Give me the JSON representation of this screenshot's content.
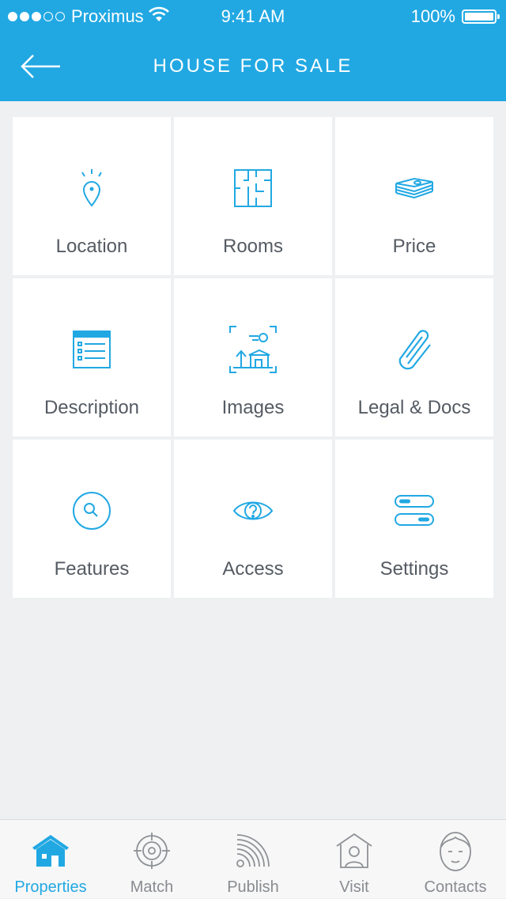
{
  "status_bar": {
    "carrier": "Proximus",
    "time": "9:41 AM",
    "battery": "100%"
  },
  "header": {
    "title": "HOUSE FOR SALE",
    "back_icon": "arrow-left-icon"
  },
  "tiles": [
    {
      "label": "Location",
      "icon": "location-pin-icon"
    },
    {
      "label": "Rooms",
      "icon": "floor-plan-icon"
    },
    {
      "label": "Price",
      "icon": "money-stack-icon"
    },
    {
      "label": "Description",
      "icon": "list-document-icon"
    },
    {
      "label": "Images",
      "icon": "image-frame-icon"
    },
    {
      "label": "Legal & Docs",
      "icon": "paperclip-icon"
    },
    {
      "label": "Features",
      "icon": "magnifier-icon"
    },
    {
      "label": "Access",
      "icon": "eye-icon"
    },
    {
      "label": "Settings",
      "icon": "toggles-icon"
    }
  ],
  "tab_bar": {
    "items": [
      {
        "label": "Properties",
        "icon": "house-icon",
        "active": true
      },
      {
        "label": "Match",
        "icon": "target-icon",
        "active": false
      },
      {
        "label": "Publish",
        "icon": "broadcast-icon",
        "active": false
      },
      {
        "label": "Visit",
        "icon": "visit-house-icon",
        "active": false
      },
      {
        "label": "Contacts",
        "icon": "person-face-icon",
        "active": false
      }
    ]
  },
  "colors": {
    "accent": "#21a8e3",
    "background": "#eff0f2",
    "tile_label": "#555b63",
    "tab_inactive": "#888b90"
  }
}
